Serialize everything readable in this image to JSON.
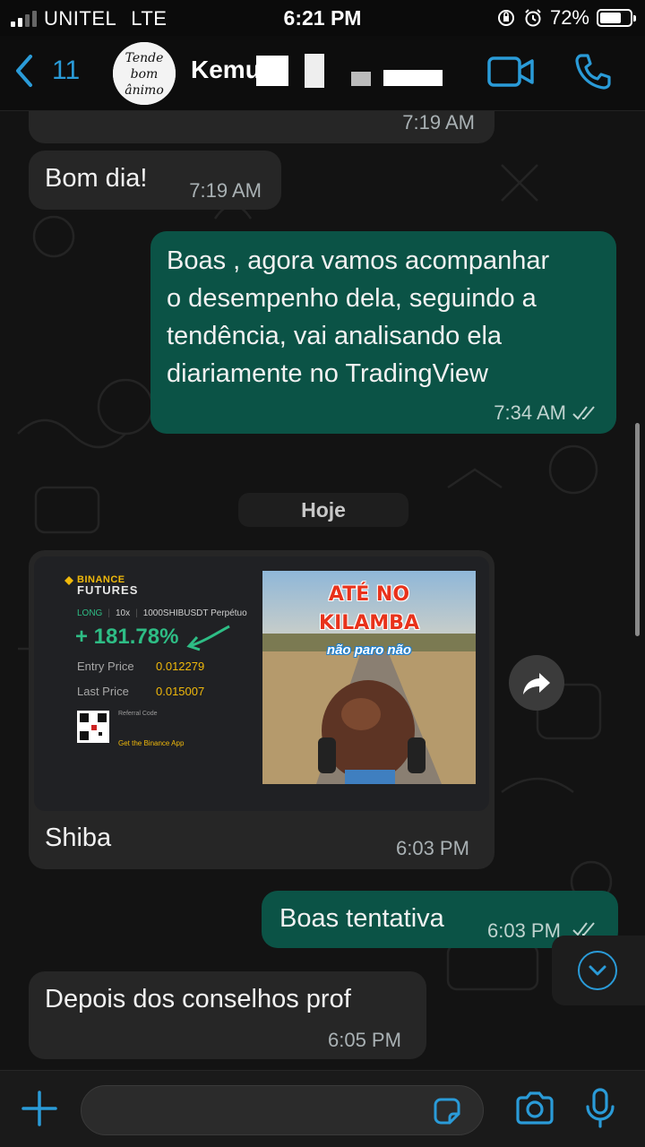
{
  "status_bar": {
    "carrier": "UNITEL",
    "network": "LTE",
    "time": "6:21 PM",
    "battery_percent": "72%",
    "battery_level": 0.72
  },
  "header": {
    "back_count": "11",
    "contact_name": "Kemuk",
    "avatar_text": [
      "Tende",
      "bom",
      "ânimo"
    ],
    "icons": [
      "back-chevron-icon",
      "video-call-icon",
      "voice-call-icon"
    ],
    "accent_color": "#2a9bd8"
  },
  "messages": [
    {
      "direction": "in",
      "text": "",
      "time": "7:19 AM"
    },
    {
      "direction": "in",
      "text": "Bom dia!",
      "time": "7:19 AM"
    },
    {
      "direction": "out",
      "lines": [
        "Boas , agora vamos acompanhar",
        "o desempenho dela, seguindo a",
        "tendência, vai analisando ela",
        "diariamente no TradingView"
      ],
      "time": "7:34 AM",
      "status": "read"
    },
    {
      "direction": "in",
      "type": "image",
      "caption": "Shiba",
      "time": "6:03 PM"
    },
    {
      "direction": "out",
      "text": "Boas tentativa",
      "time": "6:03 PM",
      "status": "read"
    },
    {
      "direction": "in",
      "text": "Depois dos conselhos prof",
      "time": "6:05 PM"
    }
  ],
  "day_separator": "Hoje",
  "image_card": {
    "brand": "BINANCE",
    "product": "FUTURES",
    "side": "LONG",
    "leverage": "10x",
    "symbol": "1000SHIBUSDT Perpétuo",
    "pnl": "+ 181.78%",
    "entry_label": "Entry Price",
    "entry_value": "0.012279",
    "last_label": "Last Price",
    "last_value": "0.015007",
    "referral": "Referral Code",
    "app": "Get the Binance App",
    "meme_line1": "ATÉ NO",
    "meme_line2": "KILAMBA",
    "meme_line3": "não paro não"
  },
  "input_bar": {
    "placeholder": "",
    "icons": [
      "plus-icon",
      "sticker-icon",
      "camera-icon",
      "microphone-icon"
    ]
  },
  "colors": {
    "incoming_bubble": "#262626",
    "outgoing_bubble": "#0b5346",
    "profit_green": "#2ebd85",
    "binance_yellow": "#f0b90b"
  }
}
